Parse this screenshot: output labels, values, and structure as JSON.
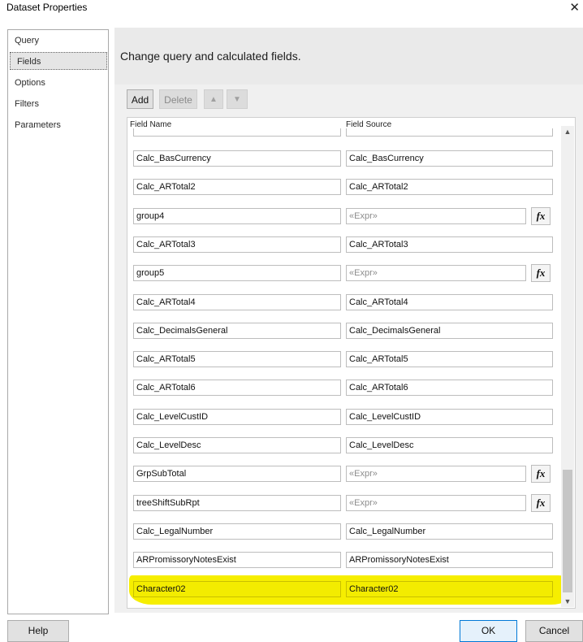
{
  "window": {
    "title": "Dataset Properties",
    "close_glyph": "✕"
  },
  "nav": {
    "items": [
      {
        "label": "Query",
        "selected": false
      },
      {
        "label": "Fields",
        "selected": true
      },
      {
        "label": "Options",
        "selected": false
      },
      {
        "label": "Filters",
        "selected": false
      },
      {
        "label": "Parameters",
        "selected": false
      }
    ]
  },
  "main": {
    "heading": "Change query and calculated fields.",
    "toolbar": {
      "add_label": "Add",
      "delete_label": "Delete",
      "up_icon": "arrow-up-icon",
      "down_icon": "arrow-down-icon"
    },
    "grid": {
      "col_name_header": "Field Name",
      "col_source_header": "Field Source",
      "fx_label": "fx",
      "rows": [
        {
          "name": "Calc_BasCurrency",
          "source": "Calc_BasCurrency",
          "expr": false,
          "highlight": false
        },
        {
          "name": "Calc_ARTotal2",
          "source": "Calc_ARTotal2",
          "expr": false,
          "highlight": false
        },
        {
          "name": "group4",
          "source": "«Expr»",
          "expr": true,
          "highlight": false
        },
        {
          "name": "Calc_ARTotal3",
          "source": "Calc_ARTotal3",
          "expr": false,
          "highlight": false
        },
        {
          "name": "group5",
          "source": "«Expr»",
          "expr": true,
          "highlight": false
        },
        {
          "name": "Calc_ARTotal4",
          "source": "Calc_ARTotal4",
          "expr": false,
          "highlight": false
        },
        {
          "name": "Calc_DecimalsGeneral",
          "source": "Calc_DecimalsGeneral",
          "expr": false,
          "highlight": false
        },
        {
          "name": "Calc_ARTotal5",
          "source": "Calc_ARTotal5",
          "expr": false,
          "highlight": false
        },
        {
          "name": "Calc_ARTotal6",
          "source": "Calc_ARTotal6",
          "expr": false,
          "highlight": false
        },
        {
          "name": "Calc_LevelCustID",
          "source": "Calc_LevelCustID",
          "expr": false,
          "highlight": false
        },
        {
          "name": "Calc_LevelDesc",
          "source": "Calc_LevelDesc",
          "expr": false,
          "highlight": false
        },
        {
          "name": "GrpSubTotal",
          "source": "«Expr»",
          "expr": true,
          "highlight": false
        },
        {
          "name": "treeShiftSubRpt",
          "source": "«Expr»",
          "expr": true,
          "highlight": false
        },
        {
          "name": "Calc_LegalNumber",
          "source": "Calc_LegalNumber",
          "expr": false,
          "highlight": false
        },
        {
          "name": "ARPromissoryNotesExist",
          "source": "ARPromissoryNotesExist",
          "expr": false,
          "highlight": false
        },
        {
          "name": "Character02",
          "source": "Character02",
          "expr": false,
          "highlight": true
        }
      ]
    }
  },
  "footer": {
    "help_label": "Help",
    "ok_label": "OK",
    "cancel_label": "Cancel"
  },
  "colors": {
    "highlight": "#f3ec00",
    "accent": "#0078d7"
  }
}
